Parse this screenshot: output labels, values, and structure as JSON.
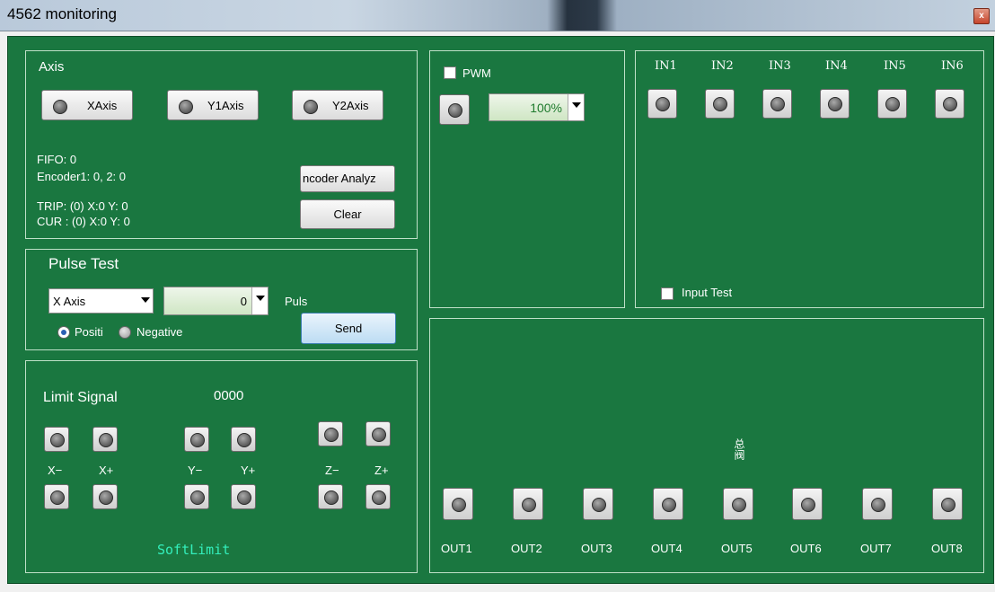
{
  "window": {
    "title": "4562 monitoring",
    "close_glyph": "x"
  },
  "axis": {
    "heading": "Axis",
    "buttons": [
      "XAxis",
      "Y1Axis",
      "Y2Axis"
    ],
    "fifo": "FIFO: 0",
    "encoder": "Encoder1: 0, 2: 0",
    "trip": "TRIP: (0) X:0 Y: 0",
    "cur": "CUR : (0) X:0 Y: 0",
    "encoder_analyze_label": "ncoder Analyz",
    "clear_label": "Clear"
  },
  "pulse_test": {
    "heading": "Pulse Test",
    "axis_select": "X Axis",
    "pulse_value": "0",
    "unit": "Puls",
    "positive_label": "Positi",
    "negative_label": "Negative",
    "send_label": "Send"
  },
  "limit": {
    "heading": "Limit Signal",
    "code": "0000",
    "labels": [
      "X−",
      "X+",
      "Y−",
      "Y+",
      "Z−",
      "Z+"
    ],
    "softlimit": "SoftLimit"
  },
  "pwm": {
    "label": "PWM",
    "value": "100%"
  },
  "inputs": {
    "labels": [
      "IN1",
      "IN2",
      "IN3",
      "IN4",
      "IN5",
      "IN6"
    ],
    "input_test_label": "Input Test"
  },
  "outputs": {
    "labels": [
      "OUT1",
      "OUT2",
      "OUT3",
      "OUT4",
      "OUT5",
      "OUT6",
      "OUT7",
      "OUT8"
    ],
    "center_glyph": "总阀"
  }
}
